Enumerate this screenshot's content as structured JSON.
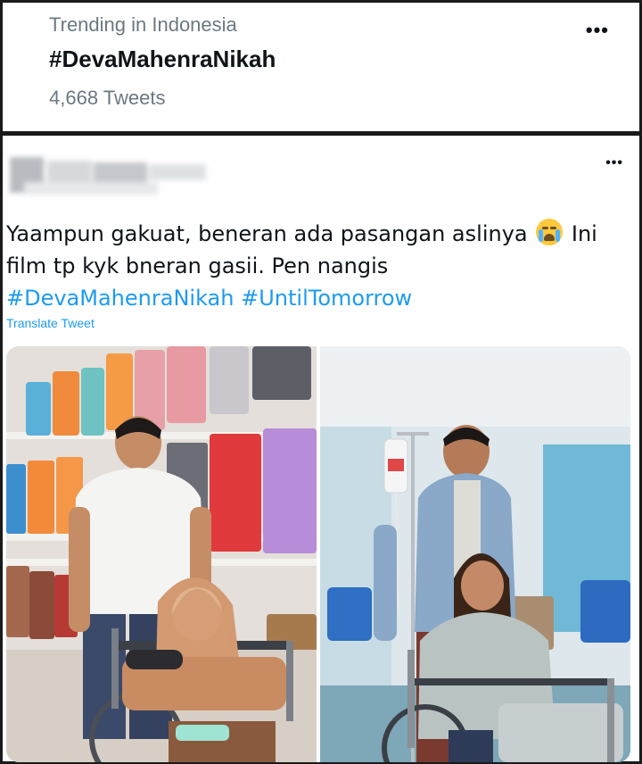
{
  "trend": {
    "context": "Trending in Indonesia",
    "title": "#DevaMahenraNikah",
    "count": "4,668 Tweets",
    "more_icon": "more-horizontal-icon"
  },
  "tweet": {
    "more_icon": "more-horizontal-icon",
    "text_line1_before": "Yaampun gakuat, beneran ada pasangan aslinya",
    "emoji": "loudly-crying-face-icon",
    "text_line1_after": "Ini",
    "text_line2": "film tp kyk bneran gasii. Pen nangis",
    "hashtag1": "#DevaMahenraNikah",
    "hashtag2": "#UntilTomorrow",
    "translate": "Translate Tweet"
  },
  "colors": {
    "link": "#1d9bf0",
    "secondary_text": "#6b7882",
    "primary_text": "#0f1419",
    "border": "#1a1a1a"
  }
}
